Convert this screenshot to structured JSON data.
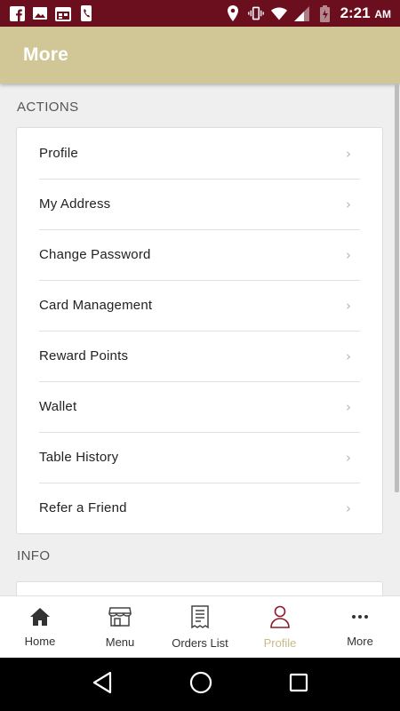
{
  "status_bar": {
    "time": "2:21",
    "ampm": "AM",
    "left_icons": [
      "facebook-icon",
      "image-icon",
      "calendar-icon",
      "phone-icon"
    ],
    "right_icons": [
      "location-icon",
      "vibrate-icon",
      "wifi-icon",
      "signal-icon",
      "battery-icon"
    ]
  },
  "header": {
    "title": "More"
  },
  "sections": {
    "actions": {
      "label": "ACTIONS",
      "items": [
        {
          "label": "Profile"
        },
        {
          "label": "My Address"
        },
        {
          "label": "Change Password"
        },
        {
          "label": "Card Management"
        },
        {
          "label": "Reward Points"
        },
        {
          "label": "Wallet"
        },
        {
          "label": "Table History"
        },
        {
          "label": "Refer a Friend"
        }
      ]
    },
    "info": {
      "label": "INFO"
    }
  },
  "bottom_nav": {
    "items": [
      {
        "label": "Home",
        "icon": "home-icon"
      },
      {
        "label": "Menu",
        "icon": "store-icon"
      },
      {
        "label": "Orders List",
        "icon": "receipt-icon"
      },
      {
        "label": "Profile",
        "icon": "person-icon",
        "active": true
      },
      {
        "label": "More",
        "icon": "more-dots-icon"
      }
    ]
  },
  "colors": {
    "status_bar": "#6b0f1f",
    "header": "#d1c796",
    "active_nav": "#c9b98a",
    "active_icon": "#8b1a2b"
  }
}
